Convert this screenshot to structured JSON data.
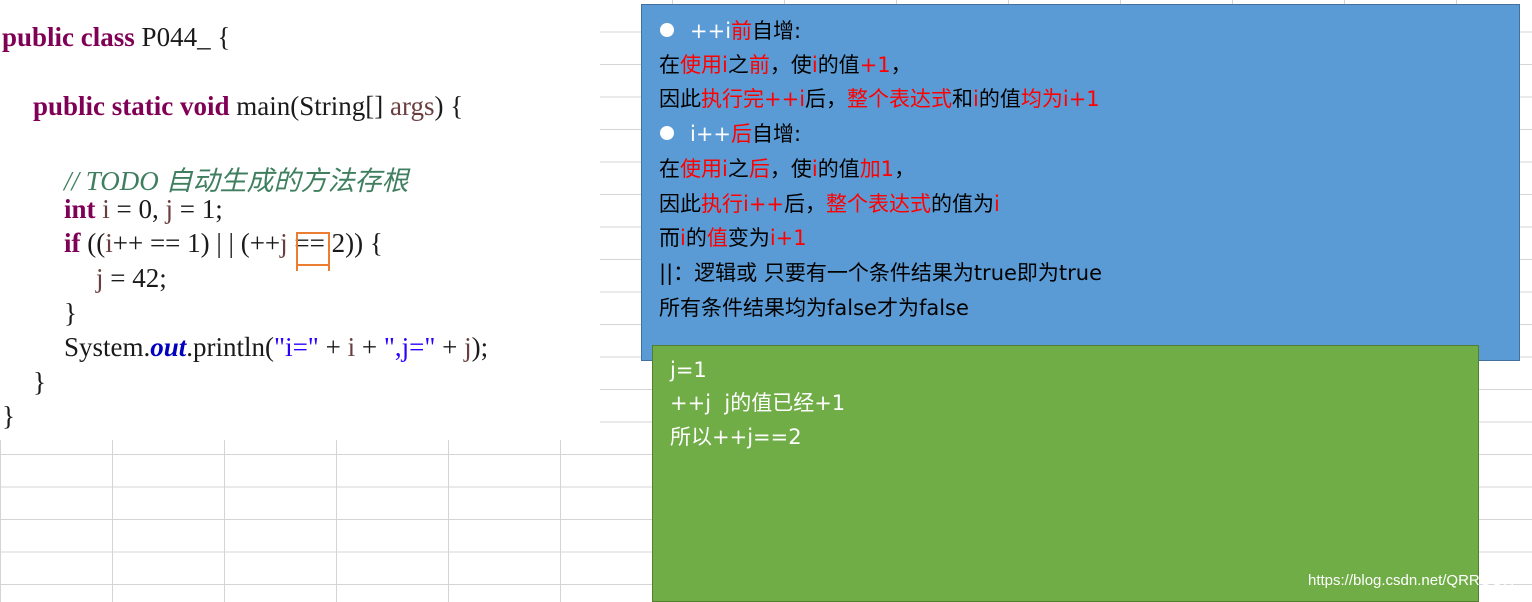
{
  "code": {
    "line1": {
      "kw": "public class",
      "rest": " P044_ {"
    },
    "line2": {
      "kw": "public static void",
      "rest": " main(String[] ",
      "arg": "args",
      "end": ") {"
    },
    "line3": {
      "comment": "// TODO 自动生成的方法存根"
    },
    "line4": {
      "kw": "int",
      "a": " ",
      "v1": "i",
      "b": " = 0, ",
      "v2": "j",
      "c": " = 1;"
    },
    "line5": {
      "kw": "if",
      "a": " ((",
      "v1": "i",
      "b": "++ == 1) | | (++",
      "v2": "j",
      "c": " == 2)) {"
    },
    "line6": {
      "v": "j",
      "rest": " = 42;"
    },
    "line7": {
      "text": "}"
    },
    "line8": {
      "a": "System.",
      "field": "out",
      "b": ".println(",
      "s1": "\"i=\"",
      "c": " + ",
      "v1": "i",
      "d": " + ",
      "s2": "\",j=\"",
      "e": " + ",
      "v2": "j",
      "f": ");"
    },
    "line9": {
      "text": "}"
    },
    "line10": {
      "text": "}"
    }
  },
  "notes": {
    "n1": {
      "a": "++i",
      "b": "前",
      "c": "自增:"
    },
    "n2": {
      "a": "在",
      "b": "使用",
      "c": "i",
      "d": "之",
      "e": "前",
      "f": "，使",
      "g": "i",
      "h": "的值",
      "i": "+1",
      "j": "，"
    },
    "n3": {
      "a": "因此",
      "b": "执行完++i",
      "c": "后，",
      "d": "整个表达式",
      "e": "和",
      "f": "i",
      "g": "的值",
      "h": "均为i+1"
    },
    "n4": {
      "a": "i++",
      "b": "后",
      "c": "自增:"
    },
    "n5": {
      "a": "在",
      "b": "使用",
      "c": "i",
      "d": "之",
      "e": "后",
      "f": "，使",
      "g": "i",
      "h": "的值",
      "i": "加1",
      "j": "，"
    },
    "n6": {
      "a": "因此",
      "b": "执行i++",
      "c": "后，",
      "d": "整个表达式",
      "e": "的值为",
      "f": "i"
    },
    "n7": {
      "a": "而",
      "b": "i",
      "c": "的",
      "d": "值",
      "e": "变为",
      "f": "i+1"
    },
    "n8": {
      "text": "||：逻辑或 只要有一个条件结果为true即为true"
    },
    "n9": {
      "text": "所有条件结果均为false才为false"
    }
  },
  "green": {
    "l1": "j=1",
    "l2": "++j  j的值已经+1",
    "l3": "所以++j==2"
  },
  "watermark": "https://blog.csdn.net/QRRQQR",
  "colors": {
    "blue_note": "#5b9bd5",
    "green_note": "#70ad47",
    "highlight": "#ed7d31",
    "red_text": "#ff0000"
  }
}
